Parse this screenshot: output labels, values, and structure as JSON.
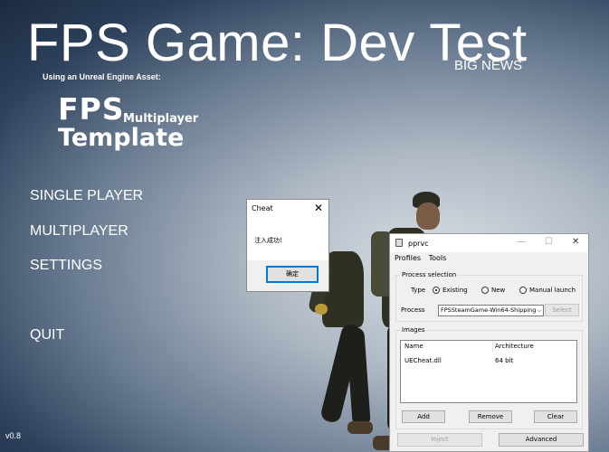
{
  "game": {
    "title": "FPS Game: Dev Test",
    "big_news": "BIG NEWS",
    "subtitle": "Using an Unreal Engine Asset:",
    "logo": {
      "line1": "FPS",
      "line2": "Multiplayer",
      "line3": "Template"
    },
    "menu": [
      "SINGLE PLAYER",
      "MULTIPLAYER",
      "SETTINGS",
      "QUIT"
    ],
    "version": "v0.8"
  },
  "cheat_dialog": {
    "title": "Cheat",
    "close_glyph": "✕",
    "message": "注入成功!",
    "ok_label": "确定"
  },
  "injector": {
    "title": "pprvc",
    "controls": {
      "minimize": "—",
      "maximize": "☐",
      "close": "✕"
    },
    "menu": [
      "Profiles",
      "Tools"
    ],
    "process_selection": {
      "caption": "Process selection",
      "type_label": "Type",
      "types": [
        {
          "label": "Existing",
          "selected": true
        },
        {
          "label": "New",
          "selected": false
        },
        {
          "label": "Manual launch",
          "selected": false
        }
      ],
      "process_label": "Process",
      "process_value": "FPSSteamGame-Win64-Shipping",
      "select_label": "Select"
    },
    "images": {
      "caption": "Images",
      "columns": [
        "Name",
        "Architecture"
      ],
      "rows": [
        {
          "name": "UECheat.dll",
          "arch": "64 bit"
        }
      ]
    },
    "buttons": {
      "add": "Add",
      "remove": "Remove",
      "clear": "Clear",
      "inject": "Inject",
      "advanced": "Advanced"
    }
  }
}
